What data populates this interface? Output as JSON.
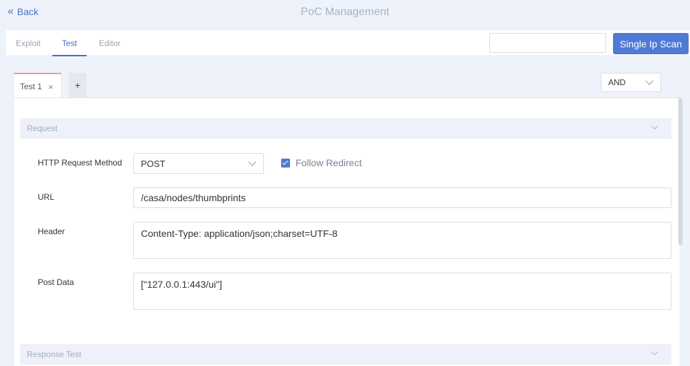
{
  "header": {
    "back_label": "Back",
    "title": "PoC Management"
  },
  "tabs": {
    "items": [
      "Exploit",
      "Test",
      "Editor"
    ],
    "active": "Test"
  },
  "scan": {
    "ip_value": "",
    "button_label": "Single Ip Scan"
  },
  "tests": {
    "tab_label": "Test 1",
    "close_symbol": "×",
    "add_symbol": "+",
    "logic_value": "AND"
  },
  "request": {
    "section_title": "Request",
    "method_label": "HTTP Request Method",
    "method_value": "POST",
    "follow_redirect_label": "Follow Redirect",
    "follow_redirect_checked": true,
    "url_label": "URL",
    "url_value": "/casa/nodes/thumbprints",
    "header_label": "Header",
    "header_value": "Content-Type: application/json;charset=UTF-8",
    "post_data_label": "Post Data",
    "post_data_value": "[\"127.0.0.1:443/ui\"]"
  },
  "response": {
    "section_title": "Response Test"
  },
  "colors": {
    "accent": "#4f7ad6",
    "active_tab_border": "#f0a070"
  }
}
